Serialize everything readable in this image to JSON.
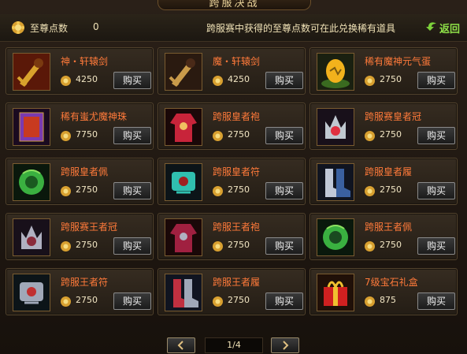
{
  "title": "跨服决战",
  "header": {
    "points_label": "至尊点数",
    "points_value": "0",
    "notice": "跨服赛中获得的至尊点数可在此兑换稀有道具",
    "back_label": "返回"
  },
  "buy_label": "购买",
  "items": [
    {
      "name": "神・轩辕剑",
      "price": "4250",
      "icon": "golden-sword-icon",
      "colors": [
        "#d9a22c",
        "#7a3a10"
      ]
    },
    {
      "name": "魔・轩辕剑",
      "price": "4250",
      "icon": "dark-sword-icon",
      "colors": [
        "#c89a4a",
        "#4a2a18"
      ]
    },
    {
      "name": "稀有魔神元气蛋",
      "price": "2750",
      "icon": "egg-icon",
      "colors": [
        "#f2b21c",
        "#7a5a10"
      ]
    },
    {
      "name": "稀有蚩尤魔神珠",
      "price": "7750",
      "icon": "card-icon",
      "colors": [
        "#7a3ab0",
        "#c83a20"
      ]
    },
    {
      "name": "跨服皇者袍",
      "price": "2750",
      "icon": "robe-icon",
      "colors": [
        "#c8243a",
        "#f0c060"
      ]
    },
    {
      "name": "跨服赛皇者冠",
      "price": "2750",
      "icon": "crown-icon",
      "colors": [
        "#e03040",
        "#c0c8d0"
      ]
    },
    {
      "name": "跨服皇者佩",
      "price": "2750",
      "icon": "pendant-icon",
      "colors": [
        "#3ab040",
        "#1a5a20"
      ]
    },
    {
      "name": "跨服皇者符",
      "price": "2750",
      "icon": "talisman-icon",
      "colors": [
        "#30c0b0",
        "#a02020"
      ]
    },
    {
      "name": "跨服皇者履",
      "price": "2750",
      "icon": "boots-icon",
      "colors": [
        "#c0c8d8",
        "#3a60a0"
      ]
    },
    {
      "name": "跨服赛王者冠",
      "price": "2750",
      "icon": "crown-icon",
      "colors": [
        "#8a2a3a",
        "#b0b0c0"
      ]
    },
    {
      "name": "跨服王者袍",
      "price": "2750",
      "icon": "robe-icon",
      "colors": [
        "#a02040",
        "#b0b0c0"
      ]
    },
    {
      "name": "跨服王者佩",
      "price": "2750",
      "icon": "pendant-icon",
      "colors": [
        "#3ab040",
        "#1a4a20"
      ]
    },
    {
      "name": "跨服王者符",
      "price": "2750",
      "icon": "talisman-icon",
      "colors": [
        "#a0a8b8",
        "#c03030"
      ]
    },
    {
      "name": "跨服王者履",
      "price": "2750",
      "icon": "boots-icon",
      "colors": [
        "#c03040",
        "#a0a8b8"
      ]
    },
    {
      "name": "7级宝石礼盒",
      "price": "875",
      "icon": "gift-box-icon",
      "colors": [
        "#d02020",
        "#f0c030"
      ]
    }
  ],
  "pager": {
    "info": "1/4"
  },
  "colors": {
    "item_name": "#ff7a3a",
    "back": "#8ee048"
  }
}
